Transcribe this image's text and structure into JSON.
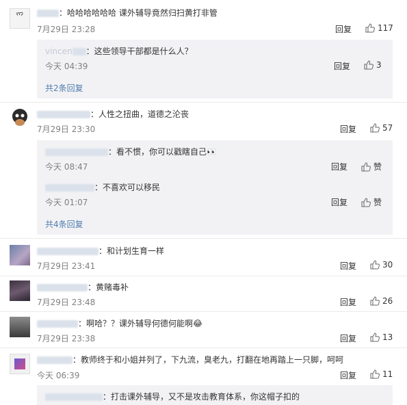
{
  "comments": [
    {
      "text": "：哈哈哈哈哈哈 课外辅导竟然归扫黄打非管",
      "time": "7月29日 23:28",
      "reply": "回复",
      "likes": "117",
      "subs": [
        {
          "name": "vincen",
          "text": "：这些领导干部都是什么人？",
          "time": "今天 04:39",
          "reply": "回复",
          "likes": "3"
        }
      ],
      "expand": "共2条回复"
    },
    {
      "text": "：人性之扭曲，道德之沦丧",
      "time": "7月29日 23:30",
      "reply": "回复",
      "likes": "57",
      "subs": [
        {
          "text": "：看不惯，你可以戳瞎自己👀",
          "time": "今天 08:47",
          "reply": "回复",
          "likes": "赞"
        },
        {
          "text": "：不喜欢可以移民",
          "time": "今天 01:07",
          "reply": "回复",
          "likes": "赞"
        }
      ],
      "expand": "共4条回复"
    },
    {
      "text": "：和计划生育一样",
      "time": "7月29日 23:41",
      "reply": "回复",
      "likes": "30"
    },
    {
      "text": "：黄赌毒补",
      "time": "7月29日 23:48",
      "reply": "回复",
      "likes": "26"
    },
    {
      "text": "：啊哈？？课外辅导何德何能啊😂",
      "time": "7月29日 23:38",
      "reply": "回复",
      "likes": "13"
    },
    {
      "text": "：教师终于和小姐并列了，下九流，臭老九，打翻在地再踏上一只脚，呵呵",
      "time": "今天 06:39",
      "reply": "回复",
      "likes": "11",
      "subs": [
        {
          "text": "：打击课外辅导，又不是攻击教育体系，你这帽子扣的"
        }
      ]
    }
  ],
  "colors": {
    "link": "#507daf",
    "time": "#808080",
    "subbg": "#f2f2f5"
  }
}
